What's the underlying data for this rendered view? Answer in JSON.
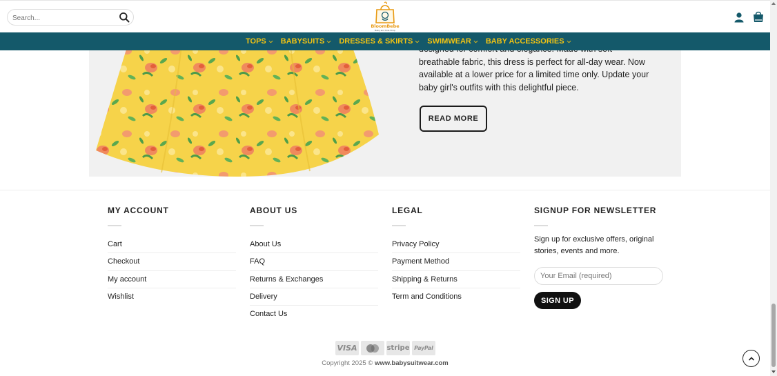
{
  "header": {
    "search_placeholder": "Search...",
    "logo_text": "BloomBebe",
    "logo_subtext": "Baby and Kids Shop",
    "icons": {
      "search": "search-icon",
      "user": "user-icon",
      "cart": "shopping-bag-icon"
    }
  },
  "nav": {
    "items": [
      {
        "label": "TOPS"
      },
      {
        "label": "BABYSUITS"
      },
      {
        "label": "DRESSES & SKIRTS"
      },
      {
        "label": "SWIMWEAR"
      },
      {
        "label": "BABY ACCESSORIES"
      }
    ]
  },
  "product": {
    "description": "designed for comfort and elegance. Made with soft breathable fabric, this dress is perfect for all-day wear. Now available at a lower price for a limited time only. Update your baby girl's outfits with this delightful piece.",
    "read_more_label": "READ MORE"
  },
  "footer": {
    "my_account": {
      "title": "MY ACCOUNT",
      "links": [
        "Cart",
        "Checkout",
        "My account",
        "Wishlist"
      ]
    },
    "about_us": {
      "title": "ABOUT US",
      "links": [
        "About Us",
        "FAQ",
        "Returns & Exchanges",
        "Delivery",
        "Contact Us"
      ]
    },
    "legal": {
      "title": "LEGAL",
      "links": [
        "Privacy Policy",
        "Payment Method",
        "Shipping & Returns",
        "Term and Conditions"
      ]
    },
    "newsletter": {
      "title": "SIGNUP FOR NEWSLETTER",
      "text": "Sign up for exclusive offers, original stories, events and more.",
      "email_placeholder": "Your Email (required)",
      "button_label": "SIGN UP"
    }
  },
  "payments": {
    "visa": "VISA",
    "mastercard": "",
    "stripe": "stripe",
    "paypal": "PayPal"
  },
  "copyright": {
    "prefix": "Copyright 2025 © ",
    "site": "www.babysuitwear.com"
  },
  "colors": {
    "nav_bg": "#14596a",
    "nav_text": "#f2c313",
    "product_bg": "#f1f1f1",
    "button_dark": "#111111"
  }
}
